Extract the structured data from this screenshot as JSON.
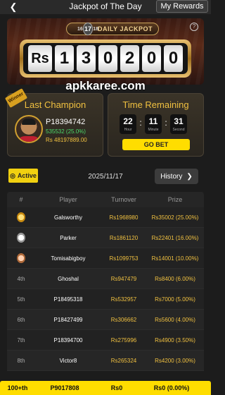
{
  "header": {
    "title": "Jackpot of The Day",
    "my_rewards": "My Rewards"
  },
  "jackpot": {
    "badge": "DAILY JACKPOT",
    "date_small_left": "16",
    "date_big": "17",
    "date_small_right": "18",
    "currency": "Rs",
    "digits": [
      "1",
      "3",
      "0",
      "2",
      "0",
      "0"
    ]
  },
  "watermark": "apkkaree.com",
  "last_champion": {
    "ribbon": "Winner",
    "title": "Last Champion",
    "name": "P18394742",
    "amount": "535532 (25.0%)",
    "prize": "Rs 48197889.00"
  },
  "time_remaining": {
    "title": "Time Remaining",
    "hour": "22",
    "hour_label": "Hour",
    "minute": "11",
    "minute_label": "Minute",
    "second": "31",
    "second_label": "Second",
    "go_bet": "GO BET"
  },
  "status": {
    "active": "Active",
    "date": "2025/11/17",
    "history": "History"
  },
  "table": {
    "headers": [
      "#",
      "Player",
      "Turnover",
      "Prize"
    ],
    "rows": [
      {
        "rank": "",
        "medal": "gold",
        "player": "Galsworthy",
        "turnover": "Rs1968980",
        "prize": "Rs35002 (25.00%)"
      },
      {
        "rank": "",
        "medal": "silver",
        "player": "Parker",
        "turnover": "Rs1861120",
        "prize": "Rs22401 (16.00%)"
      },
      {
        "rank": "",
        "medal": "bronze",
        "player": "Tomisabigboy",
        "turnover": "Rs1099753",
        "prize": "Rs14001 (10.00%)"
      },
      {
        "rank": "4th",
        "medal": "",
        "player": "Ghoshal",
        "turnover": "Rs947479",
        "prize": "Rs8400 (6.00%)"
      },
      {
        "rank": "5th",
        "medal": "",
        "player": "P18495318",
        "turnover": "Rs532957",
        "prize": "Rs7000 (5.00%)"
      },
      {
        "rank": "6th",
        "medal": "",
        "player": "P18427499",
        "turnover": "Rs306662",
        "prize": "Rs5600 (4.00%)"
      },
      {
        "rank": "7th",
        "medal": "",
        "player": "P18394700",
        "turnover": "Rs275996",
        "prize": "Rs4900 (3.50%)"
      },
      {
        "rank": "8th",
        "medal": "",
        "player": "Victor8",
        "turnover": "Rs265324",
        "prize": "Rs4200 (3.00%)"
      }
    ]
  },
  "my_rank": {
    "rank": "100+th",
    "player": "P9017808",
    "turnover": "Rs0",
    "prize": "Rs0 (0.00%)"
  },
  "colors": {
    "accent_yellow": "#ffdd00",
    "gold_text": "#f0c040",
    "green_text": "#4cd96a",
    "background": "#1c1c1c"
  },
  "icons": {
    "back": "chevron-left-icon",
    "help": "question-circle-icon",
    "history": "chevron-right-icon"
  }
}
